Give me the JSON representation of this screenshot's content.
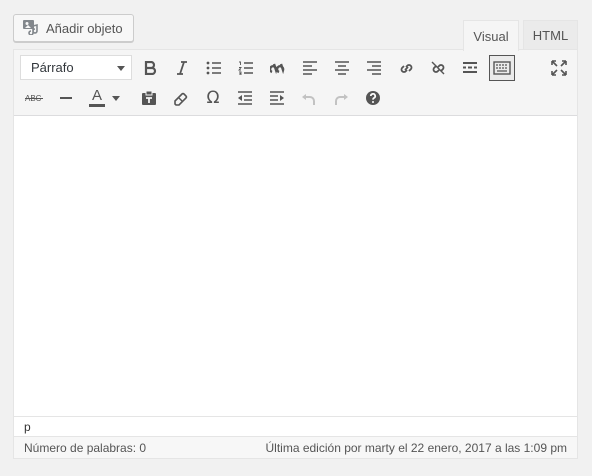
{
  "media": {
    "add_label": "Añadir objeto"
  },
  "tabs": {
    "visual": "Visual",
    "html": "HTML"
  },
  "toolbar": {
    "format_select": "Párrafo",
    "text_color_letter": "A",
    "omega": "Ω"
  },
  "editor": {
    "path": "p"
  },
  "status": {
    "word_count": "Número de palabras: 0",
    "last_edit": "Última edición por marty el 22 enero, 2017 a las 1:09 pm"
  },
  "colors": {
    "accent": "#0073aa",
    "icon": "#555555",
    "disabled": "#c2c2c2"
  }
}
